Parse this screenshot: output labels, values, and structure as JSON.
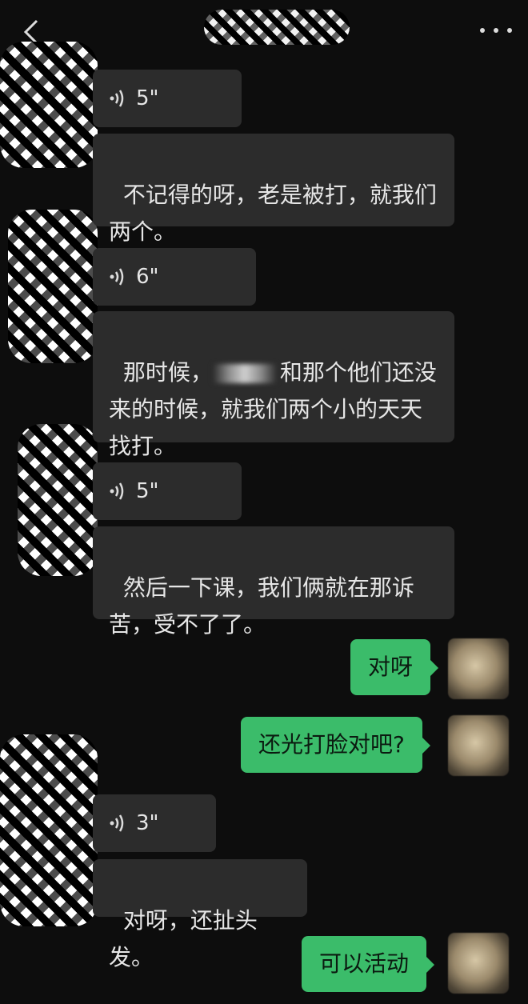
{
  "header": {
    "back_icon": "chevron-left-icon",
    "more_icon": "more-dots-icon"
  },
  "messages": [
    {
      "type": "voice",
      "side": "left",
      "duration": "5\""
    },
    {
      "type": "text",
      "side": "left",
      "text": "不记得的呀，老是被打，就我们两个。"
    },
    {
      "type": "voice",
      "side": "left",
      "duration": "6\""
    },
    {
      "type": "text",
      "side": "left",
      "text_prefix": "那时候，",
      "text_suffix": "和那个他们还没来的时候，就我们两个小的天天找打。"
    },
    {
      "type": "voice",
      "side": "left",
      "duration": "5\""
    },
    {
      "type": "text",
      "side": "left",
      "text": "然后一下课，我们俩就在那诉苦，受不了了。"
    },
    {
      "type": "text",
      "side": "right",
      "text": "对呀"
    },
    {
      "type": "text",
      "side": "right",
      "text": "还光打脸对吧?"
    },
    {
      "type": "voice",
      "side": "left",
      "duration": "3\""
    },
    {
      "type": "text",
      "side": "left",
      "text": "对呀，还扯头发。"
    },
    {
      "type": "text",
      "side": "right",
      "text": "可以活动"
    }
  ],
  "colors": {
    "background": "#0d0d0d",
    "left_bubble": "#2c2c2c",
    "right_bubble": "#3bbc6a"
  }
}
